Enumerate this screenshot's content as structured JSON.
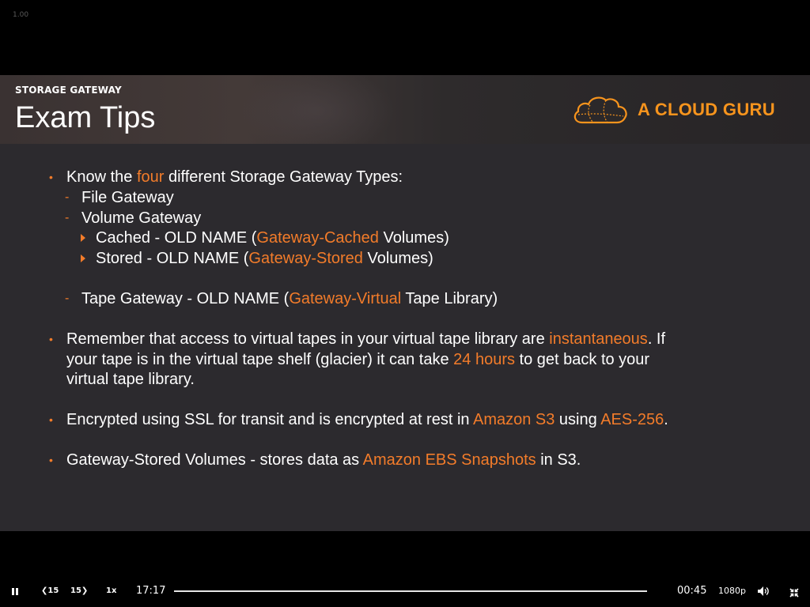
{
  "player": {
    "speed_indicator": "1.00",
    "controls": {
      "rewind_label": "15",
      "forward_label": "15",
      "speed_label": "1x",
      "elapsed": "17:17",
      "remaining": "00:45",
      "quality": "1080p"
    }
  },
  "slide": {
    "section_label": "STORAGE GATEWAY",
    "title": "Exam Tips",
    "logo_text": "A CLOUD GURU",
    "accent_color": "#f37c2a",
    "lines": {
      "l1": {
        "a": "Know the ",
        "b": "four",
        "c": " different Storage Gateway Types:"
      },
      "l2": {
        "a": "File Gateway"
      },
      "l3": {
        "a": "Volume Gateway"
      },
      "l4": {
        "a": "Cached - OLD NAME (",
        "b": "Gateway-Cached",
        "c": " Volumes)"
      },
      "l5": {
        "a": "Stored - OLD NAME (",
        "b": "Gateway-Stored",
        "c": " Volumes)"
      },
      "l6": {
        "a": "Tape Gateway - OLD NAME (",
        "b": "Gateway-Virtual",
        "c": " Tape Library)"
      },
      "l7": {
        "a": "Remember that access to virtual tapes in your virtual tape library are ",
        "b": "instantaneous",
        "c": ". If"
      },
      "l8": {
        "a": "your tape is in the virtual tape shelf (glacier) it can take ",
        "b": "24 hours",
        "c": " to get back to your"
      },
      "l9": {
        "a": "virtual tape library."
      },
      "l10": {
        "a": "Encrypted using SSL for transit and is encrypted at rest in ",
        "b": "Amazon S3",
        "c": " using ",
        "d": "AES-256",
        "e": "."
      },
      "l11": {
        "a": "Gateway-Stored Volumes - stores data as ",
        "b": "Amazon EBS Snapshots",
        "c": " in S3."
      }
    }
  }
}
